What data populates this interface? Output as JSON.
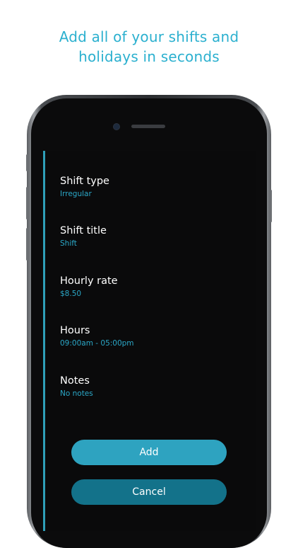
{
  "headline": {
    "line1": "Add all of your shifts and",
    "line2": "holidays in seconds"
  },
  "form": {
    "fields": [
      {
        "label": "Shift type",
        "value": "Irregular"
      },
      {
        "label": "Shift title",
        "value": "Shift"
      },
      {
        "label": "Hourly rate",
        "value": "$8.50"
      },
      {
        "label": "Hours",
        "value": "09:00am - 05:00pm"
      },
      {
        "label": "Notes",
        "value": "No notes"
      }
    ],
    "add_label": "Add",
    "cancel_label": "Cancel"
  },
  "colors": {
    "accent": "#2bb0cf",
    "add_button": "#2ea3c0",
    "cancel_button": "#13728a",
    "screen_bg": "#0a0a0b"
  }
}
